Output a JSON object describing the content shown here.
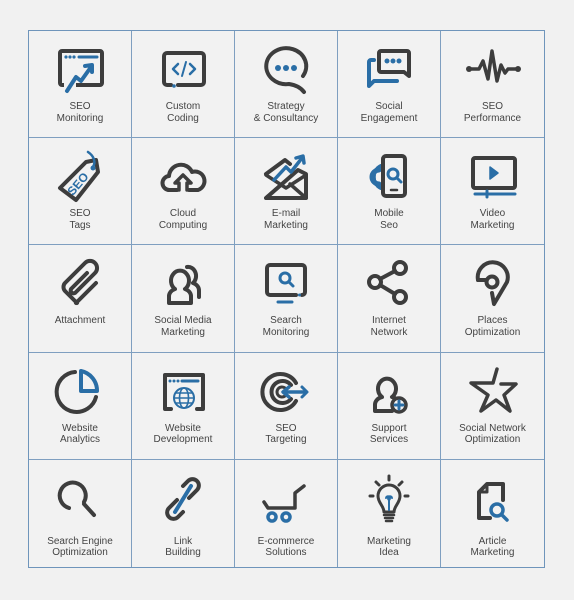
{
  "colors": {
    "dark": "#3d3d3d",
    "accent": "#2a6ea6",
    "grid": "#7f9fc0",
    "background": "#f1f1f1"
  },
  "icons": [
    {
      "icon": "seo-monitoring-icon",
      "line1": "SEO",
      "line2": "Monitoring"
    },
    {
      "icon": "custom-coding-icon",
      "line1": "Custom",
      "line2": "Coding"
    },
    {
      "icon": "strategy-consultancy-icon",
      "line1": "Strategy",
      "line2": "& Consultancy"
    },
    {
      "icon": "social-engagement-icon",
      "line1": "Social",
      "line2": "Engagement"
    },
    {
      "icon": "seo-performance-icon",
      "line1": "SEO",
      "line2": "Performance"
    },
    {
      "icon": "seo-tags-icon",
      "line1": "SEO",
      "line2": "Tags",
      "tag_text": "SEO"
    },
    {
      "icon": "cloud-computing-icon",
      "line1": "Cloud",
      "line2": "Computing"
    },
    {
      "icon": "email-marketing-icon",
      "line1": "E-mail",
      "line2": "Marketing"
    },
    {
      "icon": "mobile-seo-icon",
      "line1": "Mobile",
      "line2": "Seo"
    },
    {
      "icon": "video-marketing-icon",
      "line1": "Video",
      "line2": "Marketing"
    },
    {
      "icon": "attachment-icon",
      "line1": "Attachment",
      "line2": ""
    },
    {
      "icon": "social-media-marketing-icon",
      "line1": "Social Media",
      "line2": "Marketing"
    },
    {
      "icon": "search-monitoring-icon",
      "line1": "Search",
      "line2": "Monitoring"
    },
    {
      "icon": "internet-network-icon",
      "line1": "Internet",
      "line2": "Network"
    },
    {
      "icon": "places-optimization-icon",
      "line1": "Places",
      "line2": "Optimization"
    },
    {
      "icon": "website-analytics-icon",
      "line1": "Website",
      "line2": "Analytics"
    },
    {
      "icon": "website-development-icon",
      "line1": "Website",
      "line2": "Development"
    },
    {
      "icon": "seo-targeting-icon",
      "line1": "SEO",
      "line2": "Targeting"
    },
    {
      "icon": "support-services-icon",
      "line1": "Support",
      "line2": "Services"
    },
    {
      "icon": "social-network-optimization-icon",
      "line1": "Social Network",
      "line2": "Optimization"
    },
    {
      "icon": "search-engine-optimization-icon",
      "line1": "Search Engine",
      "line2": "Optimization"
    },
    {
      "icon": "link-building-icon",
      "line1": "Link",
      "line2": "Building"
    },
    {
      "icon": "ecommerce-solutions-icon",
      "line1": "E-commerce",
      "line2": "Solutions"
    },
    {
      "icon": "marketing-idea-icon",
      "line1": "Marketing",
      "line2": "Idea"
    },
    {
      "icon": "article-marketing-icon",
      "line1": "Article",
      "line2": "Marketing"
    }
  ]
}
